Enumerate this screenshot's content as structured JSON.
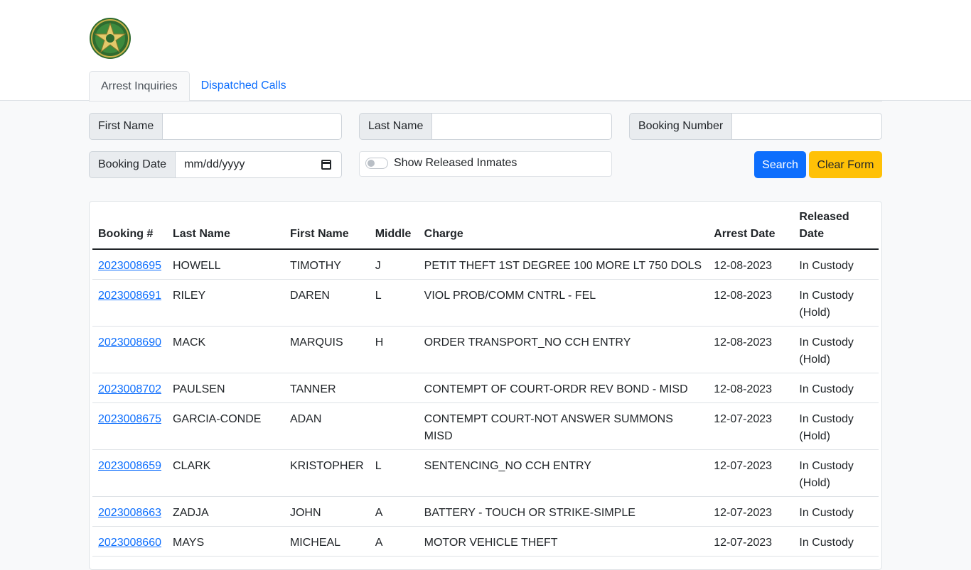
{
  "header": {
    "logo_icon": "sheriff-star-badge",
    "tabs": [
      "Arrest Inquiries",
      "Dispatched Calls"
    ]
  },
  "search_form": {
    "first_name": {
      "label": "First Name",
      "value": ""
    },
    "last_name": {
      "label": "Last Name",
      "value": ""
    },
    "booking_number": {
      "label": "Booking Number",
      "value": ""
    },
    "booking_date": {
      "label": "Booking Date",
      "placeholder": "mm/dd/yyyy"
    },
    "show_released": {
      "label": "Show Released Inmates",
      "checked": false
    },
    "search_label": "Search",
    "clear_label": "Clear Form"
  },
  "colors": {
    "primary": "#0d6efd",
    "warning": "#ffc107",
    "page_bg": "#f8f9fa"
  },
  "results": {
    "columns": [
      "Booking #",
      "Last Name",
      "First Name",
      "Middle",
      "Charge",
      "Arrest Date",
      "Released Date"
    ],
    "rows": [
      {
        "booking": "2023008695",
        "last": "HOWELL",
        "first": "TIMOTHY",
        "middle": "J",
        "charge": "PETIT THEFT 1ST DEGREE 100 MORE LT 750 DOLS",
        "arrest_date": "12-08-2023",
        "released": "In Custody"
      },
      {
        "booking": "2023008691",
        "last": "RILEY",
        "first": "DAREN",
        "middle": "L",
        "charge": "VIOL PROB/COMM CNTRL - FEL",
        "arrest_date": "12-08-2023",
        "released": "In Custody (Hold)"
      },
      {
        "booking": "2023008690",
        "last": "MACK",
        "first": "MARQUIS",
        "middle": "H",
        "charge": "ORDER TRANSPORT_NO CCH ENTRY",
        "arrest_date": "12-08-2023",
        "released": "In Custody (Hold)"
      },
      {
        "booking": "2023008702",
        "last": "PAULSEN",
        "first": "TANNER",
        "middle": "",
        "charge": "CONTEMPT OF COURT-ORDR REV BOND - MISD",
        "arrest_date": "12-08-2023",
        "released": "In Custody"
      },
      {
        "booking": "2023008675",
        "last": "GARCIA-CONDE",
        "first": "ADAN",
        "middle": "",
        "charge": "CONTEMPT COURT-NOT ANSWER SUMMONS MISD",
        "arrest_date": "12-07-2023",
        "released": "In Custody (Hold)"
      },
      {
        "booking": "2023008659",
        "last": "CLARK",
        "first": "KRISTOPHER",
        "middle": "L",
        "charge": "SENTENCING_NO CCH ENTRY",
        "arrest_date": "12-07-2023",
        "released": "In Custody (Hold)"
      },
      {
        "booking": "2023008663",
        "last": "ZADJA",
        "first": "JOHN",
        "middle": "A",
        "charge": "BATTERY - TOUCH OR STRIKE-SIMPLE",
        "arrest_date": "12-07-2023",
        "released": "In Custody"
      },
      {
        "booking": "2023008660",
        "last": "MAYS",
        "first": "MICHEAL",
        "middle": "A",
        "charge": "MOTOR VEHICLE THEFT",
        "arrest_date": "12-07-2023",
        "released": "In Custody"
      }
    ]
  }
}
